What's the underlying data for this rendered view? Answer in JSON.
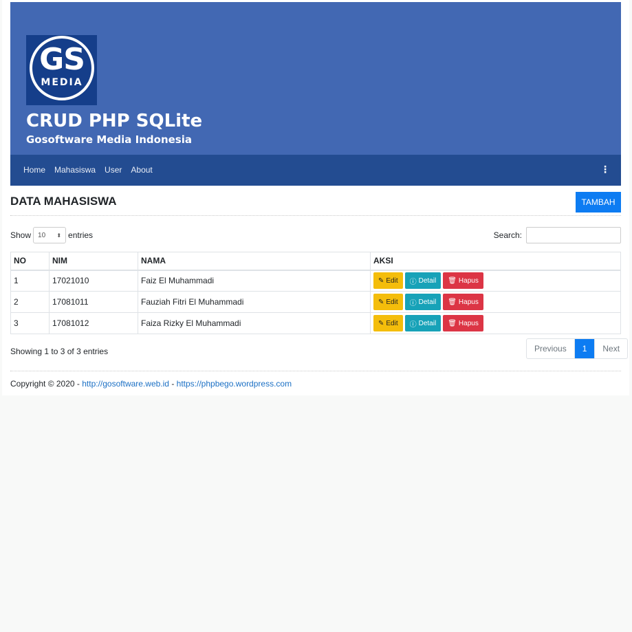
{
  "header": {
    "logo_text": "GS",
    "logo_sub": "MEDIA",
    "title": "CRUD PHP SQLite",
    "subtitle": "Gosoftware Media Indonesia"
  },
  "nav": {
    "items": [
      "Home",
      "Mahasiswa",
      "User",
      "About"
    ],
    "more_icon": "⋮"
  },
  "page": {
    "title": "DATA MAHASISWA",
    "add_button": "TAMBAH"
  },
  "table_controls": {
    "show_label": "Show",
    "entries_value": "10",
    "entries_label": "entries",
    "search_label": "Search:"
  },
  "table": {
    "headers": [
      "NO",
      "NIM",
      "NAMA",
      "AKSI"
    ],
    "rows": [
      {
        "no": "1",
        "nim": "17021010",
        "nama": "Faiz El Muhammadi"
      },
      {
        "no": "2",
        "nim": "17081011",
        "nama": "Fauziah Fitri El Muhammadi"
      },
      {
        "no": "3",
        "nim": "17081012",
        "nama": "Faiza Rizky El Muhammadi"
      }
    ],
    "actions": {
      "edit": "Edit",
      "detail": "Detail",
      "hapus": "Hapus"
    }
  },
  "pagination": {
    "info": "Showing 1 to 3 of 3 entries",
    "previous": "Previous",
    "current": "1",
    "next": "Next"
  },
  "footer": {
    "prefix": "Copyright © 2020 - ",
    "link1": "http://gosoftware.web.id",
    "sep": " - ",
    "link2": "https://phpbego.wordpress.com"
  },
  "colors": {
    "header_bg": "#4268b3",
    "navbar_bg": "#234c91",
    "primary": "#0d7cf2",
    "warning": "#f4bd0b",
    "info": "#17a2b8",
    "danger": "#dc3545"
  }
}
